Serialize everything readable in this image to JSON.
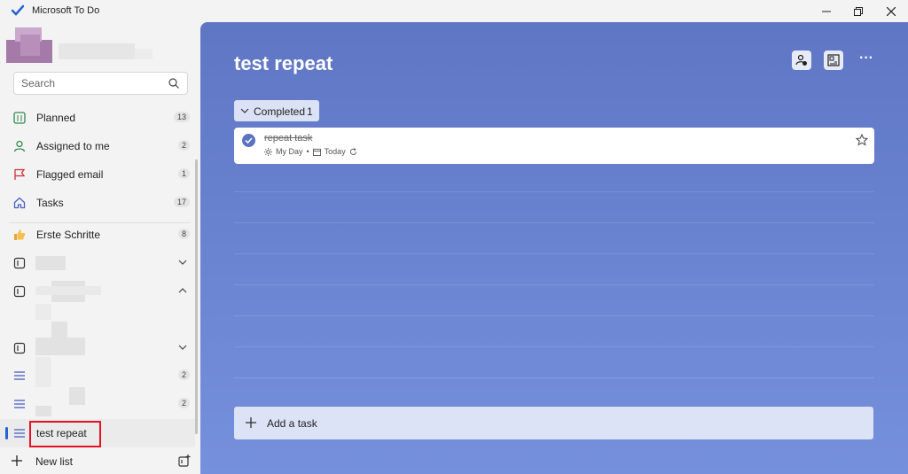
{
  "window": {
    "title": "Microsoft To Do"
  },
  "sidebar": {
    "search_placeholder": "Search",
    "items": [
      {
        "label": "Planned",
        "count": "13",
        "icon": "calendar-grid-icon"
      },
      {
        "label": "Assigned to me",
        "count": "2",
        "icon": "person-icon"
      },
      {
        "label": "Flagged email",
        "count": "1",
        "icon": "flag-icon"
      },
      {
        "label": "Tasks",
        "count": "17",
        "icon": "home-icon"
      },
      {
        "label": "Erste Schritte",
        "count": "8",
        "icon": "thumbs-up-icon"
      }
    ],
    "groups": [
      {
        "icon": "group-icon",
        "chevron": "chevron-down-icon"
      },
      {
        "icon": "group-icon",
        "chevron": "chevron-up-icon"
      },
      {
        "icon": "group-icon",
        "chevron": "chevron-down-icon"
      }
    ],
    "lists": [
      {
        "count": "2",
        "icon": "list-lines-icon"
      },
      {
        "count": "2",
        "icon": "list-lines-icon"
      },
      {
        "label": "test repeat",
        "icon": "list-lines-icon",
        "active": true
      }
    ],
    "new_list_label": "New list",
    "accent_color": "#2564cf",
    "highlight_color": "#e81123"
  },
  "main": {
    "list_title": "test repeat",
    "completed": {
      "label": "Completed",
      "count": "1"
    },
    "tasks": [
      {
        "title": "repeat task",
        "meta_my_day": "My Day",
        "meta_separator": "•",
        "meta_due": "Today",
        "completed": true
      }
    ],
    "add_task_label": "Add a task",
    "more_label": "···",
    "background_color": "#6680cc"
  }
}
